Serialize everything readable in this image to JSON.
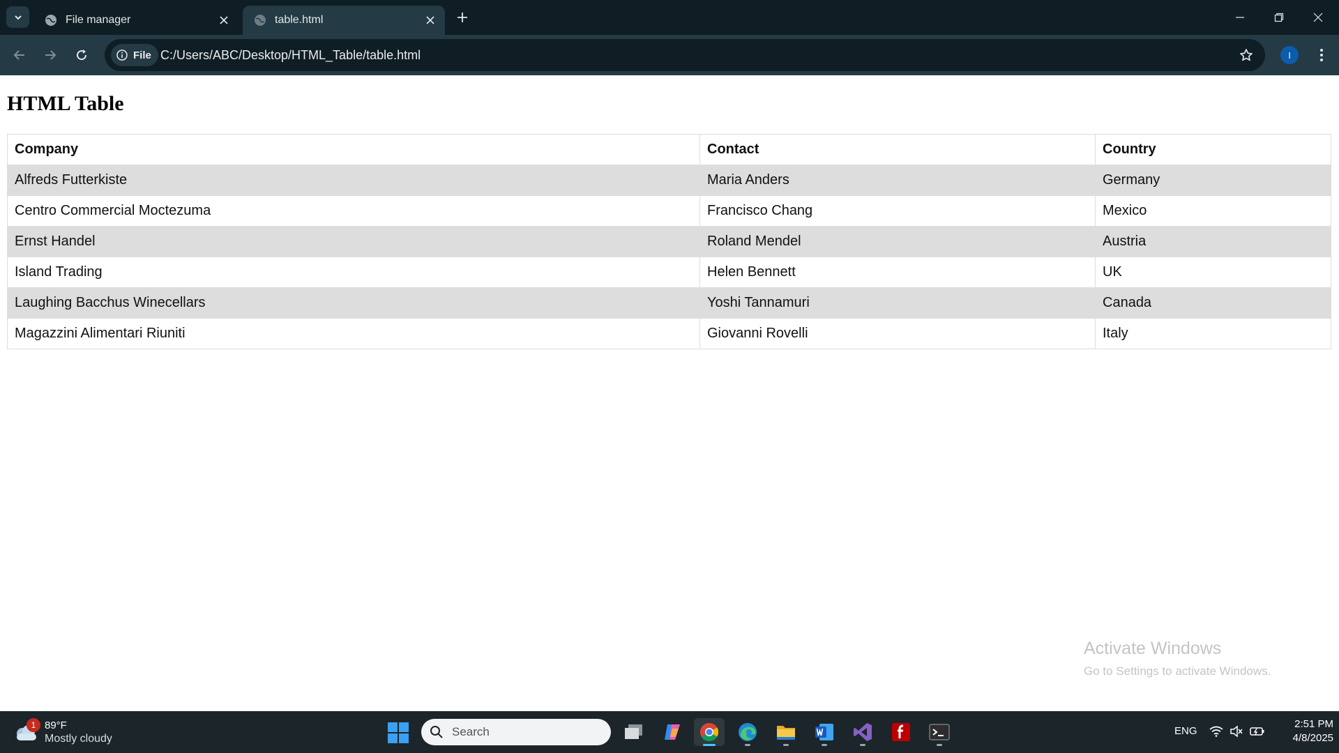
{
  "browser": {
    "tabs": [
      {
        "title": "File manager",
        "active": false
      },
      {
        "title": "table.html",
        "active": true
      }
    ],
    "site_chip": "File",
    "url": "C:/Users/ABC/Desktop/HTML_Table/table.html",
    "profile_initial": "I"
  },
  "page": {
    "heading": "HTML Table",
    "table": {
      "headers": [
        "Company",
        "Contact",
        "Country"
      ],
      "rows": [
        [
          "Alfreds Futterkiste",
          "Maria Anders",
          "Germany"
        ],
        [
          "Centro Commercial Moctezuma",
          "Francisco Chang",
          "Mexico"
        ],
        [
          "Ernst Handel",
          "Roland Mendel",
          "Austria"
        ],
        [
          "Island Trading",
          "Helen Bennett",
          "UK"
        ],
        [
          "Laughing Bacchus Winecellars",
          "Yoshi Tannamuri",
          "Canada"
        ],
        [
          "Magazzini Alimentari Riuniti",
          "Giovanni Rovelli",
          "Italy"
        ]
      ]
    },
    "watermark": {
      "title": "Activate Windows",
      "subtitle": "Go to Settings to activate Windows."
    }
  },
  "taskbar": {
    "weather": {
      "badge": "1",
      "temperature": "89°F",
      "condition": "Mostly cloudy"
    },
    "search_placeholder": "Search",
    "apps": [
      "task-view",
      "copilot",
      "chrome",
      "edge",
      "file-explorer",
      "word",
      "visual-studio",
      "filezilla",
      "terminal"
    ],
    "language": "ENG",
    "time": "2:51 PM",
    "date": "4/8/2025"
  },
  "colors": {
    "titlebar": "#0f1e24",
    "toolbar": "#243a44",
    "table_stripe": "#dddddd",
    "taskbar": "#1c2529",
    "accent": "#4cc2ff"
  }
}
